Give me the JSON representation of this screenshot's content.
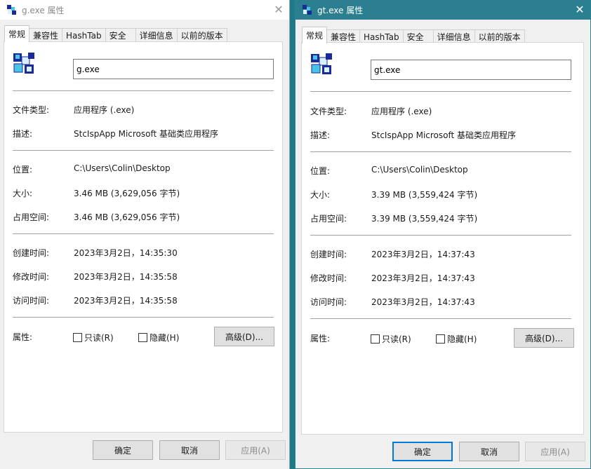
{
  "left": {
    "title": "g.exe 属性",
    "tabs": [
      "常规",
      "兼容性",
      "HashTab",
      "安全",
      "详细信息",
      "以前的版本"
    ],
    "filename": "g.exe",
    "labels": {
      "file_type": "文件类型:",
      "description": "描述:",
      "location": "位置:",
      "size": "大小:",
      "size_on_disk": "占用空间:",
      "created": "创建时间:",
      "modified": "修改时间:",
      "accessed": "访问时间:",
      "attributes": "属性:"
    },
    "values": {
      "file_type": "应用程序 (.exe)",
      "description": "StcIspApp Microsoft 基础类应用程序",
      "location": "C:\\Users\\Colin\\Desktop",
      "size": "3.46 MB (3,629,056 字节)",
      "size_on_disk": "3.46 MB (3,629,056 字节)",
      "created": "2023年3月2日，14:35:30",
      "modified": "2023年3月2日，14:35:58",
      "accessed": "2023年3月2日，14:35:58"
    },
    "readonly_label": "只读(R)",
    "hidden_label": "隐藏(H)",
    "advanced_label": "高级(D)...",
    "buttons": {
      "ok": "确定",
      "cancel": "取消",
      "apply": "应用(A)"
    },
    "close_glyph": "✕"
  },
  "right": {
    "title": "gt.exe 属性",
    "tabs": [
      "常规",
      "兼容性",
      "HashTab",
      "安全",
      "详细信息",
      "以前的版本"
    ],
    "filename": "gt.exe",
    "labels": {
      "file_type": "文件类型:",
      "description": "描述:",
      "location": "位置:",
      "size": "大小:",
      "size_on_disk": "占用空间:",
      "created": "创建时间:",
      "modified": "修改时间:",
      "accessed": "访问时间:",
      "attributes": "属性:"
    },
    "values": {
      "file_type": "应用程序 (.exe)",
      "description": "StcIspApp Microsoft 基础类应用程序",
      "location": "C:\\Users\\Colin\\Desktop",
      "size": "3.39 MB (3,559,424 字节)",
      "size_on_disk": "3.39 MB (3,559,424 字节)",
      "created": "2023年3月2日，14:37:43",
      "modified": "2023年3月2日，14:37:43",
      "accessed": "2023年3月2日，14:37:43"
    },
    "readonly_label": "只读(R)",
    "hidden_label": "隐藏(H)",
    "advanced_label": "高级(D)...",
    "buttons": {
      "ok": "确定",
      "cancel": "取消",
      "apply": "应用(A)"
    },
    "close_glyph": "✕"
  },
  "colors": {
    "active_titlebar": "#2c7f8e",
    "desktop": "#1e7a86",
    "focus_border": "#0078d7"
  },
  "icons": {
    "app": "application-blocks-icon",
    "close": "close-icon",
    "checkbox": "checkbox-icon"
  }
}
